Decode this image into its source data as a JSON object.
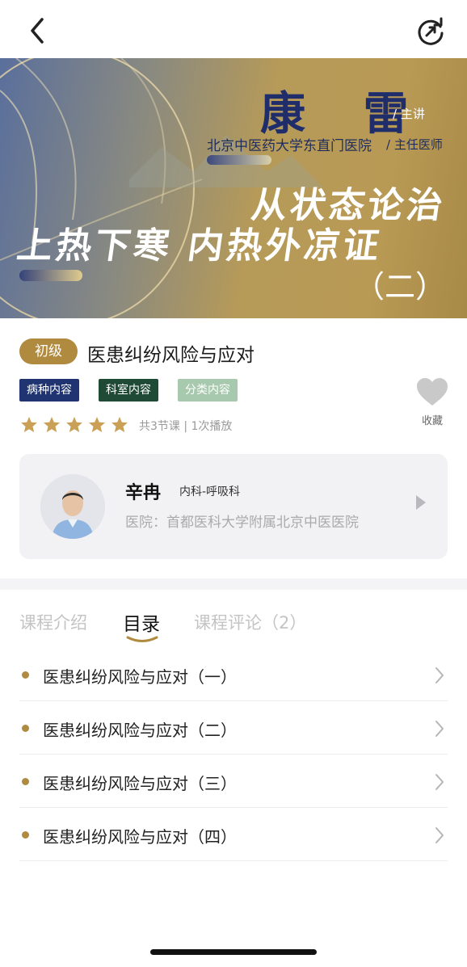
{
  "nav": {
    "back_icon": "chevron-left-icon",
    "share_icon": "share-refresh-icon"
  },
  "banner": {
    "lecturer_name": "康 雷",
    "lecturer_role": "/ 主讲",
    "hospital": "北京中医药大学东直门医院",
    "title": "/ 主任医师",
    "headline_line1": "从状态论治",
    "headline_line2": "上热下寒 内热外凉证",
    "headline_line3": "（二）"
  },
  "course": {
    "level": "初级",
    "title": "医患纠纷风险与应对",
    "tags": [
      "病种内容",
      "科室内容",
      "分类内容"
    ],
    "rating": 5,
    "stats": "共3节课 | 1次播放",
    "favorite_label": "收藏"
  },
  "teacher": {
    "name": "辛冉",
    "department": "内科-呼吸科",
    "hospital": "医院：首都医科大学附属北京中医医院"
  },
  "tabs": [
    {
      "label": "课程介绍"
    },
    {
      "label": "目录"
    },
    {
      "label": "课程评论（2）"
    }
  ],
  "active_tab": "目录",
  "chapters": [
    {
      "title": "医患纠纷风险与应对（一）"
    },
    {
      "title": "医患纠纷风险与应对（二）"
    },
    {
      "title": "医患纠纷风险与应对（三）"
    },
    {
      "title": "医患纠纷风险与应对（四）"
    }
  ],
  "colors": {
    "accent": "#b08a3e",
    "tag1": "#1f3470",
    "tag2": "#1f4a35",
    "tag3": "#a7c9ad",
    "star": "#c9a055",
    "card_bg": "#f2f2f4"
  }
}
